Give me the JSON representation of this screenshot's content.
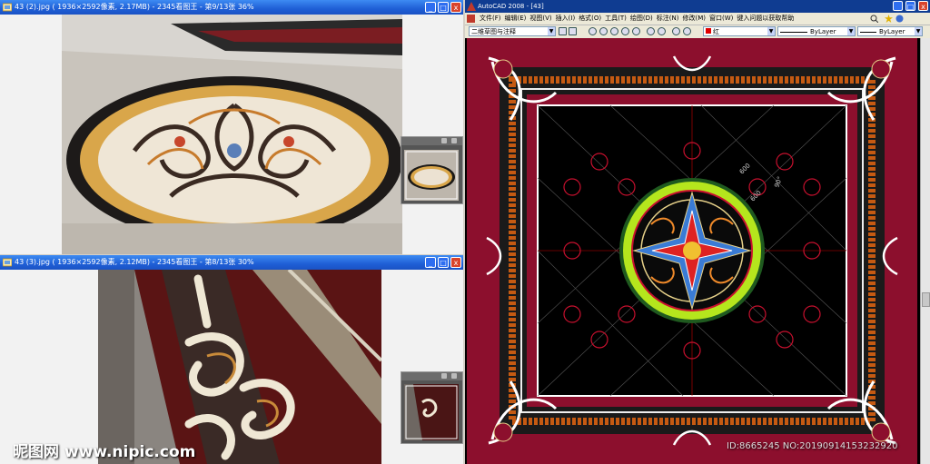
{
  "viewer_top": {
    "title": "43 (2).jpg ( 1936×2592像素, 2.17MB) - 2345看图王 - 第9/13张 36%",
    "minimize": "_",
    "maximize": "□",
    "close": "x"
  },
  "viewer_bottom": {
    "title": "43 (3).jpg ( 1936×2592像素, 2.12MB) - 2345看图王 - 第8/13张 30%",
    "minimize": "_",
    "maximize": "□",
    "close": "x"
  },
  "cad": {
    "title": "AutoCAD 2008 - [43]",
    "menu": [
      "文件(F)",
      "编辑(E)",
      "视图(V)",
      "插入(I)",
      "格式(O)",
      "工具(T)",
      "绘图(D)",
      "标注(N)",
      "修改(M)",
      "窗口(W)",
      "键入问题以获取帮助"
    ],
    "workspace": "二维草图与注释",
    "color": "红",
    "linetype": "ByLayer",
    "lineweight": "ByLayer",
    "dimensions": [
      "600",
      "600",
      "90°"
    ],
    "minimize": "_",
    "maximize": "□",
    "close": "x"
  },
  "watermark": {
    "brand": "昵图网 www.nipic.com",
    "id_text": "ID:8665245 NO:20190914153232920"
  },
  "colors": {
    "xp_blue": "#1f5fd6",
    "cad_title": "#0f3c91",
    "cad_bg": "#000000",
    "dark_red": "#8c0f2d",
    "lime": "#b5e61d"
  }
}
